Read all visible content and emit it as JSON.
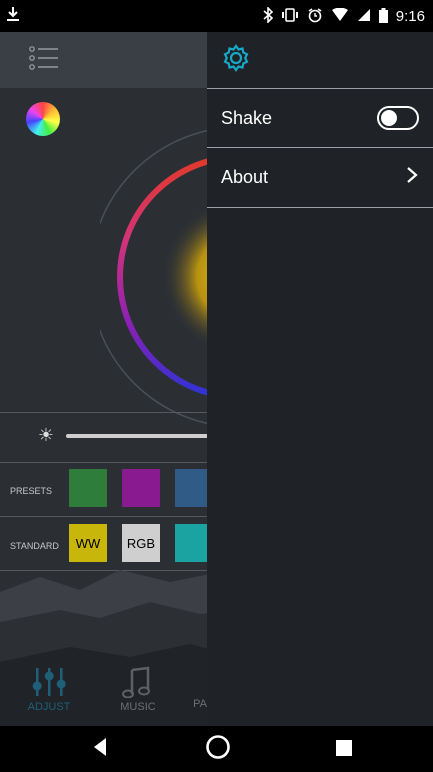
{
  "status_bar": {
    "time": "9:16",
    "left_icon": "download-icon",
    "icons": [
      "bluetooth-icon",
      "vibrate-icon",
      "alarm-icon",
      "wifi-icon",
      "cell-signal-icon",
      "battery-icon"
    ]
  },
  "background_app": {
    "presets_label": "PRESETS",
    "standard_label": "STANDARD",
    "standard_buttons": [
      "WW",
      "RGB"
    ],
    "preset_colors": [
      "#2f7d3a",
      "#8a1a8f",
      "#2f5b86"
    ],
    "tabs": [
      {
        "label": "ADJUST",
        "active": true
      },
      {
        "label": "MUSIC",
        "active": false
      },
      {
        "label": "PA",
        "active": false
      }
    ]
  },
  "drawer": {
    "header_icon": "gear-icon",
    "items": [
      {
        "label": "Shake",
        "control": "toggle",
        "toggle_on": false
      },
      {
        "label": "About",
        "control": "chevron"
      }
    ]
  },
  "colors": {
    "accent": "#17a7c7",
    "drawer_bg": "#1f2226",
    "app_bg": "#2b2f34"
  }
}
